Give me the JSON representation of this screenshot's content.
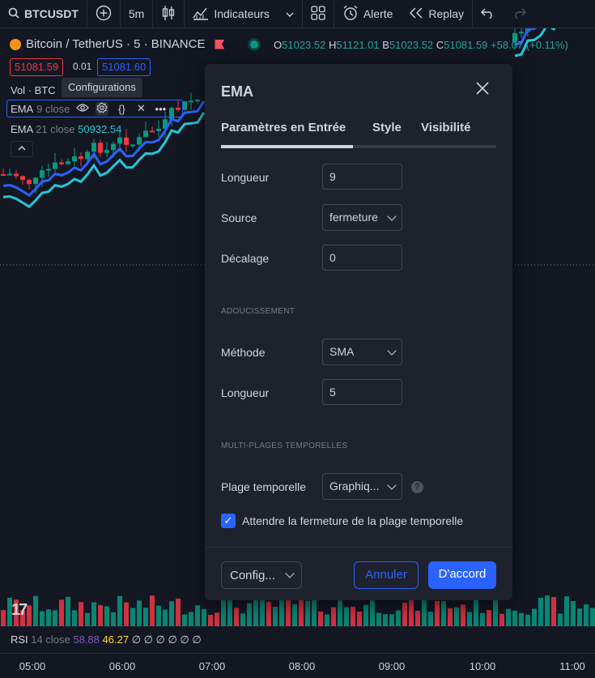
{
  "toolbar": {
    "symbol": "BTCUSDT",
    "interval": "5m",
    "indicators_label": "Indicateurs",
    "alert_label": "Alerte",
    "replay_label": "Replay"
  },
  "legend": {
    "title": "Bitcoin / TetherUS · 5 · BINANCE",
    "ohlc": {
      "o_key": "O",
      "o": "51023.52",
      "h_key": "H",
      "h": "51121.01",
      "b_key": "B",
      "b": "51023.52",
      "c_key": "C",
      "c": "51081.59",
      "change": "+58.07 (+0.11%)"
    },
    "bid": "51081.59",
    "spread": "0.01",
    "ask": "51081.60",
    "vol": "Vol · BTC",
    "tooltip": "Configurations",
    "ema9": {
      "name": "EMA",
      "params": "9 close"
    },
    "ema21": {
      "name": "EMA",
      "params": "21 close",
      "value": "50932.54"
    }
  },
  "rsi": {
    "name": "RSI",
    "params": "14 close",
    "v1": "58.88",
    "v2": "46.27",
    "empty": "∅ ∅ ∅ ∅ ∅ ∅"
  },
  "time_axis": [
    "05:00",
    "06:00",
    "07:00",
    "08:00",
    "09:00",
    "10:00",
    "11:00"
  ],
  "colors": {
    "up": "#089981",
    "down": "#f23645",
    "ema_fast": "#2962ff",
    "ema_slow": "#26c6da",
    "accent": "#2962ff"
  },
  "dialog": {
    "title": "EMA",
    "tabs": [
      "Paramètres en Entrée",
      "Style",
      "Visibilité"
    ],
    "fields": {
      "length_label": "Longueur",
      "length_value": "9",
      "source_label": "Source",
      "source_value": "fermeture",
      "offset_label": "Décalage",
      "offset_value": "0"
    },
    "smoothing": {
      "section": "ADOUCISSEMENT",
      "method_label": "Méthode",
      "method_value": "SMA",
      "length_label": "Longueur",
      "length_value": "5"
    },
    "mtf": {
      "section": "MULTI-PLAGES TEMPORELLES",
      "timeframe_label": "Plage temporelle",
      "timeframe_value": "Graphiq...",
      "wait_close_label": "Attendre la fermeture de la plage temporelle",
      "wait_close_checked": true
    },
    "footer": {
      "config_label": "Config...",
      "cancel_label": "Annuler",
      "ok_label": "D'accord"
    }
  }
}
